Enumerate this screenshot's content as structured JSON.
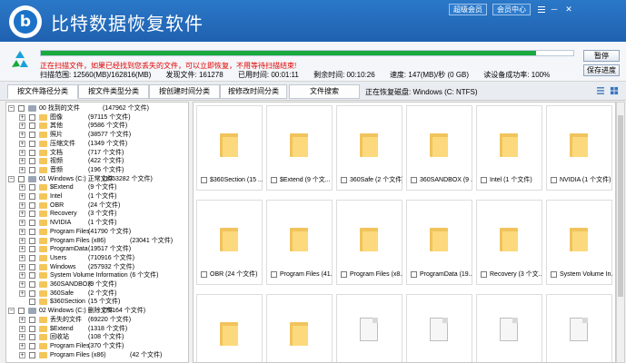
{
  "app": {
    "title": "比特数据恢复软件",
    "logo_letter": "b",
    "top_buttons": [
      "超级会员",
      "会员中心"
    ],
    "win_minimize": "─",
    "win_close": "✕"
  },
  "scan": {
    "progress_fraction": 0.93,
    "status": "正在扫描文件，如果已经找到您丢失的文件，可以立即恢复，不用等待扫描结束!",
    "range_label": "扫描范围: 12560(MB)/162816(MB)",
    "found_label": "发现文件: 161278",
    "elapsed_label": "已用时间: 00:01:11",
    "remaining_label": "剩余时间: 00:10:26",
    "speed_label": "速度: 147(MB)/秒 (0 GB)",
    "read_rate_label": "读设备成功率: 100%",
    "pause_button": "暂停",
    "save_button": "保存进度"
  },
  "tabs": [
    {
      "label": "按文件路径分类",
      "active": true
    },
    {
      "label": "按文件类型分类",
      "active": false
    },
    {
      "label": "按创建时间分类",
      "active": false
    },
    {
      "label": "按修改时间分类",
      "active": false
    },
    {
      "label": "文件搜索",
      "active": false
    }
  ],
  "current_path": "正在恢复磁盘: Windows (C: NTFS)",
  "tree": [
    {
      "level": 0,
      "expander": "−",
      "icon": "drive",
      "label": "00 找到的文件",
      "count": "(147962 个文件)"
    },
    {
      "level": 1,
      "expander": "+",
      "icon": "folder",
      "label": "图像",
      "count": "(97115 个文件)"
    },
    {
      "level": 1,
      "expander": "+",
      "icon": "folder",
      "label": "其他",
      "count": "(9586 个文件)"
    },
    {
      "level": 1,
      "expander": "+",
      "icon": "folder",
      "label": "照片",
      "count": "(38577 个文件)"
    },
    {
      "level": 1,
      "expander": "+",
      "icon": "folder",
      "label": "压缩文件",
      "count": "(1349 个文件)"
    },
    {
      "level": 1,
      "expander": "+",
      "icon": "folder",
      "label": "文档",
      "count": "(717 个文件)"
    },
    {
      "level": 1,
      "expander": "+",
      "icon": "folder",
      "label": "视频",
      "count": "(422 个文件)"
    },
    {
      "level": 1,
      "expander": "+",
      "icon": "folder",
      "label": "音频",
      "count": "(196 个文件)"
    },
    {
      "level": 0,
      "expander": "−",
      "icon": "drive",
      "label": "01 Windows (C:) 正常文件",
      "count": "(1053282 个文件)"
    },
    {
      "level": 1,
      "expander": "+",
      "icon": "folder",
      "label": "$Extend",
      "count": "(9 个文件)"
    },
    {
      "level": 1,
      "expander": "+",
      "icon": "folder",
      "label": "Intel",
      "count": "(1 个文件)"
    },
    {
      "level": 1,
      "expander": "+",
      "icon": "folder",
      "label": "OBR",
      "count": "(24 个文件)"
    },
    {
      "level": 1,
      "expander": "+",
      "icon": "folder",
      "label": "Recovery",
      "count": "(3 个文件)"
    },
    {
      "level": 1,
      "expander": "+",
      "icon": "folder",
      "label": "NVIDIA",
      "count": "(1 个文件)"
    },
    {
      "level": 1,
      "expander": "+",
      "icon": "folder",
      "label": "Program Files",
      "count": "(41790 个文件)"
    },
    {
      "level": 1,
      "expander": "+",
      "icon": "folder",
      "label": "Program Files (x86)",
      "count": "(23041 个文件)"
    },
    {
      "level": 1,
      "expander": "+",
      "icon": "folder",
      "label": "ProgramData",
      "count": "(19517 个文件)"
    },
    {
      "level": 1,
      "expander": "+",
      "icon": "folder",
      "label": "Users",
      "count": "(710916 个文件)"
    },
    {
      "level": 1,
      "expander": "+",
      "icon": "folder",
      "label": "Windows",
      "count": "(257932 个文件)"
    },
    {
      "level": 1,
      "expander": "+",
      "icon": "folder",
      "label": "System Volume Information",
      "count": "(6 个文件)"
    },
    {
      "level": 1,
      "expander": "+",
      "icon": "folder",
      "label": "360SANDBOX",
      "count": "(9 个文件)"
    },
    {
      "level": 1,
      "expander": "+",
      "icon": "folder",
      "label": "360Safe",
      "count": "(2 个文件)"
    },
    {
      "level": 1,
      "expander": "",
      "icon": "folder",
      "label": "$360Section",
      "count": "(15 个文件)"
    },
    {
      "level": 0,
      "expander": "−",
      "icon": "drive",
      "label": "02 Windows (C:) 删除文件",
      "count": "(79164 个文件)"
    },
    {
      "level": 1,
      "expander": "+",
      "icon": "folder",
      "label": "丢失的文件",
      "count": "(69220 个文件)"
    },
    {
      "level": 1,
      "expander": "+",
      "icon": "folder",
      "label": "$Extend",
      "count": "(1318 个文件)"
    },
    {
      "level": 1,
      "expander": "+",
      "icon": "folder",
      "label": "回收站",
      "count": "(108 个文件)"
    },
    {
      "level": 1,
      "expander": "+",
      "icon": "folder",
      "label": "Program Files",
      "count": "(370 个文件)"
    },
    {
      "level": 1,
      "expander": "+",
      "icon": "folder",
      "label": "Program Files (x86)",
      "count": "(42 个文件)"
    }
  ],
  "tiles": [
    {
      "kind": "folder",
      "label": "$360Section (15 ..."
    },
    {
      "kind": "folder",
      "label": "$Extend (9 个文..."
    },
    {
      "kind": "folder",
      "label": "360Safe (2 个文件)"
    },
    {
      "kind": "folder",
      "label": "360SANDBOX (9 ..."
    },
    {
      "kind": "folder",
      "label": "Intel (1 个文件)"
    },
    {
      "kind": "folder",
      "label": "NVIDIA (1 个文件)"
    },
    {
      "kind": "folder",
      "label": "OBR (24 个文件)"
    },
    {
      "kind": "folder",
      "label": "Program Files (41..."
    },
    {
      "kind": "folder",
      "label": "Program Files (x8..."
    },
    {
      "kind": "folder",
      "label": "ProgramData (19..."
    },
    {
      "kind": "folder",
      "label": "Recovery (3 个文..."
    },
    {
      "kind": "folder",
      "label": "System Volume In..."
    },
    {
      "kind": "folder",
      "label": ""
    },
    {
      "kind": "folder",
      "label": ""
    },
    {
      "kind": "doc",
      "label": ""
    },
    {
      "kind": "doc",
      "label": ""
    },
    {
      "kind": "doc",
      "label": ""
    },
    {
      "kind": "doc",
      "label": ""
    }
  ]
}
